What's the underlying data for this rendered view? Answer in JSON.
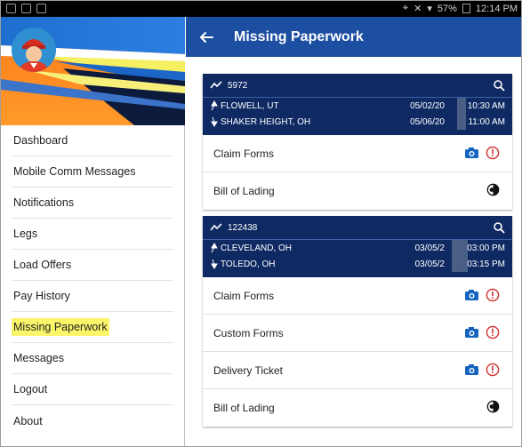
{
  "status_bar": {
    "right_text": "57%",
    "time": "12:14 PM"
  },
  "drawer": {
    "menu": [
      {
        "label": "Dashboard"
      },
      {
        "label": "Mobile Comm Messages"
      },
      {
        "label": "Notifications"
      },
      {
        "label": "Legs"
      },
      {
        "label": "Load Offers"
      },
      {
        "label": "Pay History"
      },
      {
        "label": "Missing Paperwork",
        "active": true
      },
      {
        "label": "Messages"
      },
      {
        "label": "Logout"
      },
      {
        "label": "About"
      }
    ]
  },
  "appbar": {
    "title": "Missing Paperwork",
    "back_icon": "arrow-left-icon"
  },
  "loads": [
    {
      "number": "5972",
      "origin": {
        "city": "FLOWELL, UT",
        "date": "05/02/20",
        "time": "10:30 AM"
      },
      "destination": {
        "city": "SHAKER HEIGHT, OH",
        "date": "05/06/20",
        "time": "11:00 AM"
      },
      "documents": [
        {
          "label": "Claim Forms",
          "icons": [
            "camera-icon",
            "alert-icon"
          ]
        },
        {
          "label": "Bill of Lading",
          "icons": [
            "half-circle-icon"
          ]
        }
      ]
    },
    {
      "number": "122438",
      "origin": {
        "city": "CLEVELAND, OH",
        "date": "03/05/2",
        "time": "03:00 PM"
      },
      "destination": {
        "city": "TOLEDO, OH",
        "date": "03/05/2",
        "time": "03:15 PM"
      },
      "documents": [
        {
          "label": "Claim Forms",
          "icons": [
            "camera-icon",
            "alert-icon"
          ]
        },
        {
          "label": "Custom Forms",
          "icons": [
            "camera-icon",
            "alert-icon"
          ]
        },
        {
          "label": "Delivery Ticket",
          "icons": [
            "camera-icon",
            "alert-icon"
          ]
        },
        {
          "label": "Bill of Lading",
          "icons": [
            "half-circle-icon"
          ]
        }
      ]
    }
  ],
  "colors": {
    "appbar": "#1c4ea1",
    "card_header": "#0f2a63",
    "active_highlight": "#fbf56a",
    "alert": "#d32f2f",
    "camera": "#1565c0"
  }
}
